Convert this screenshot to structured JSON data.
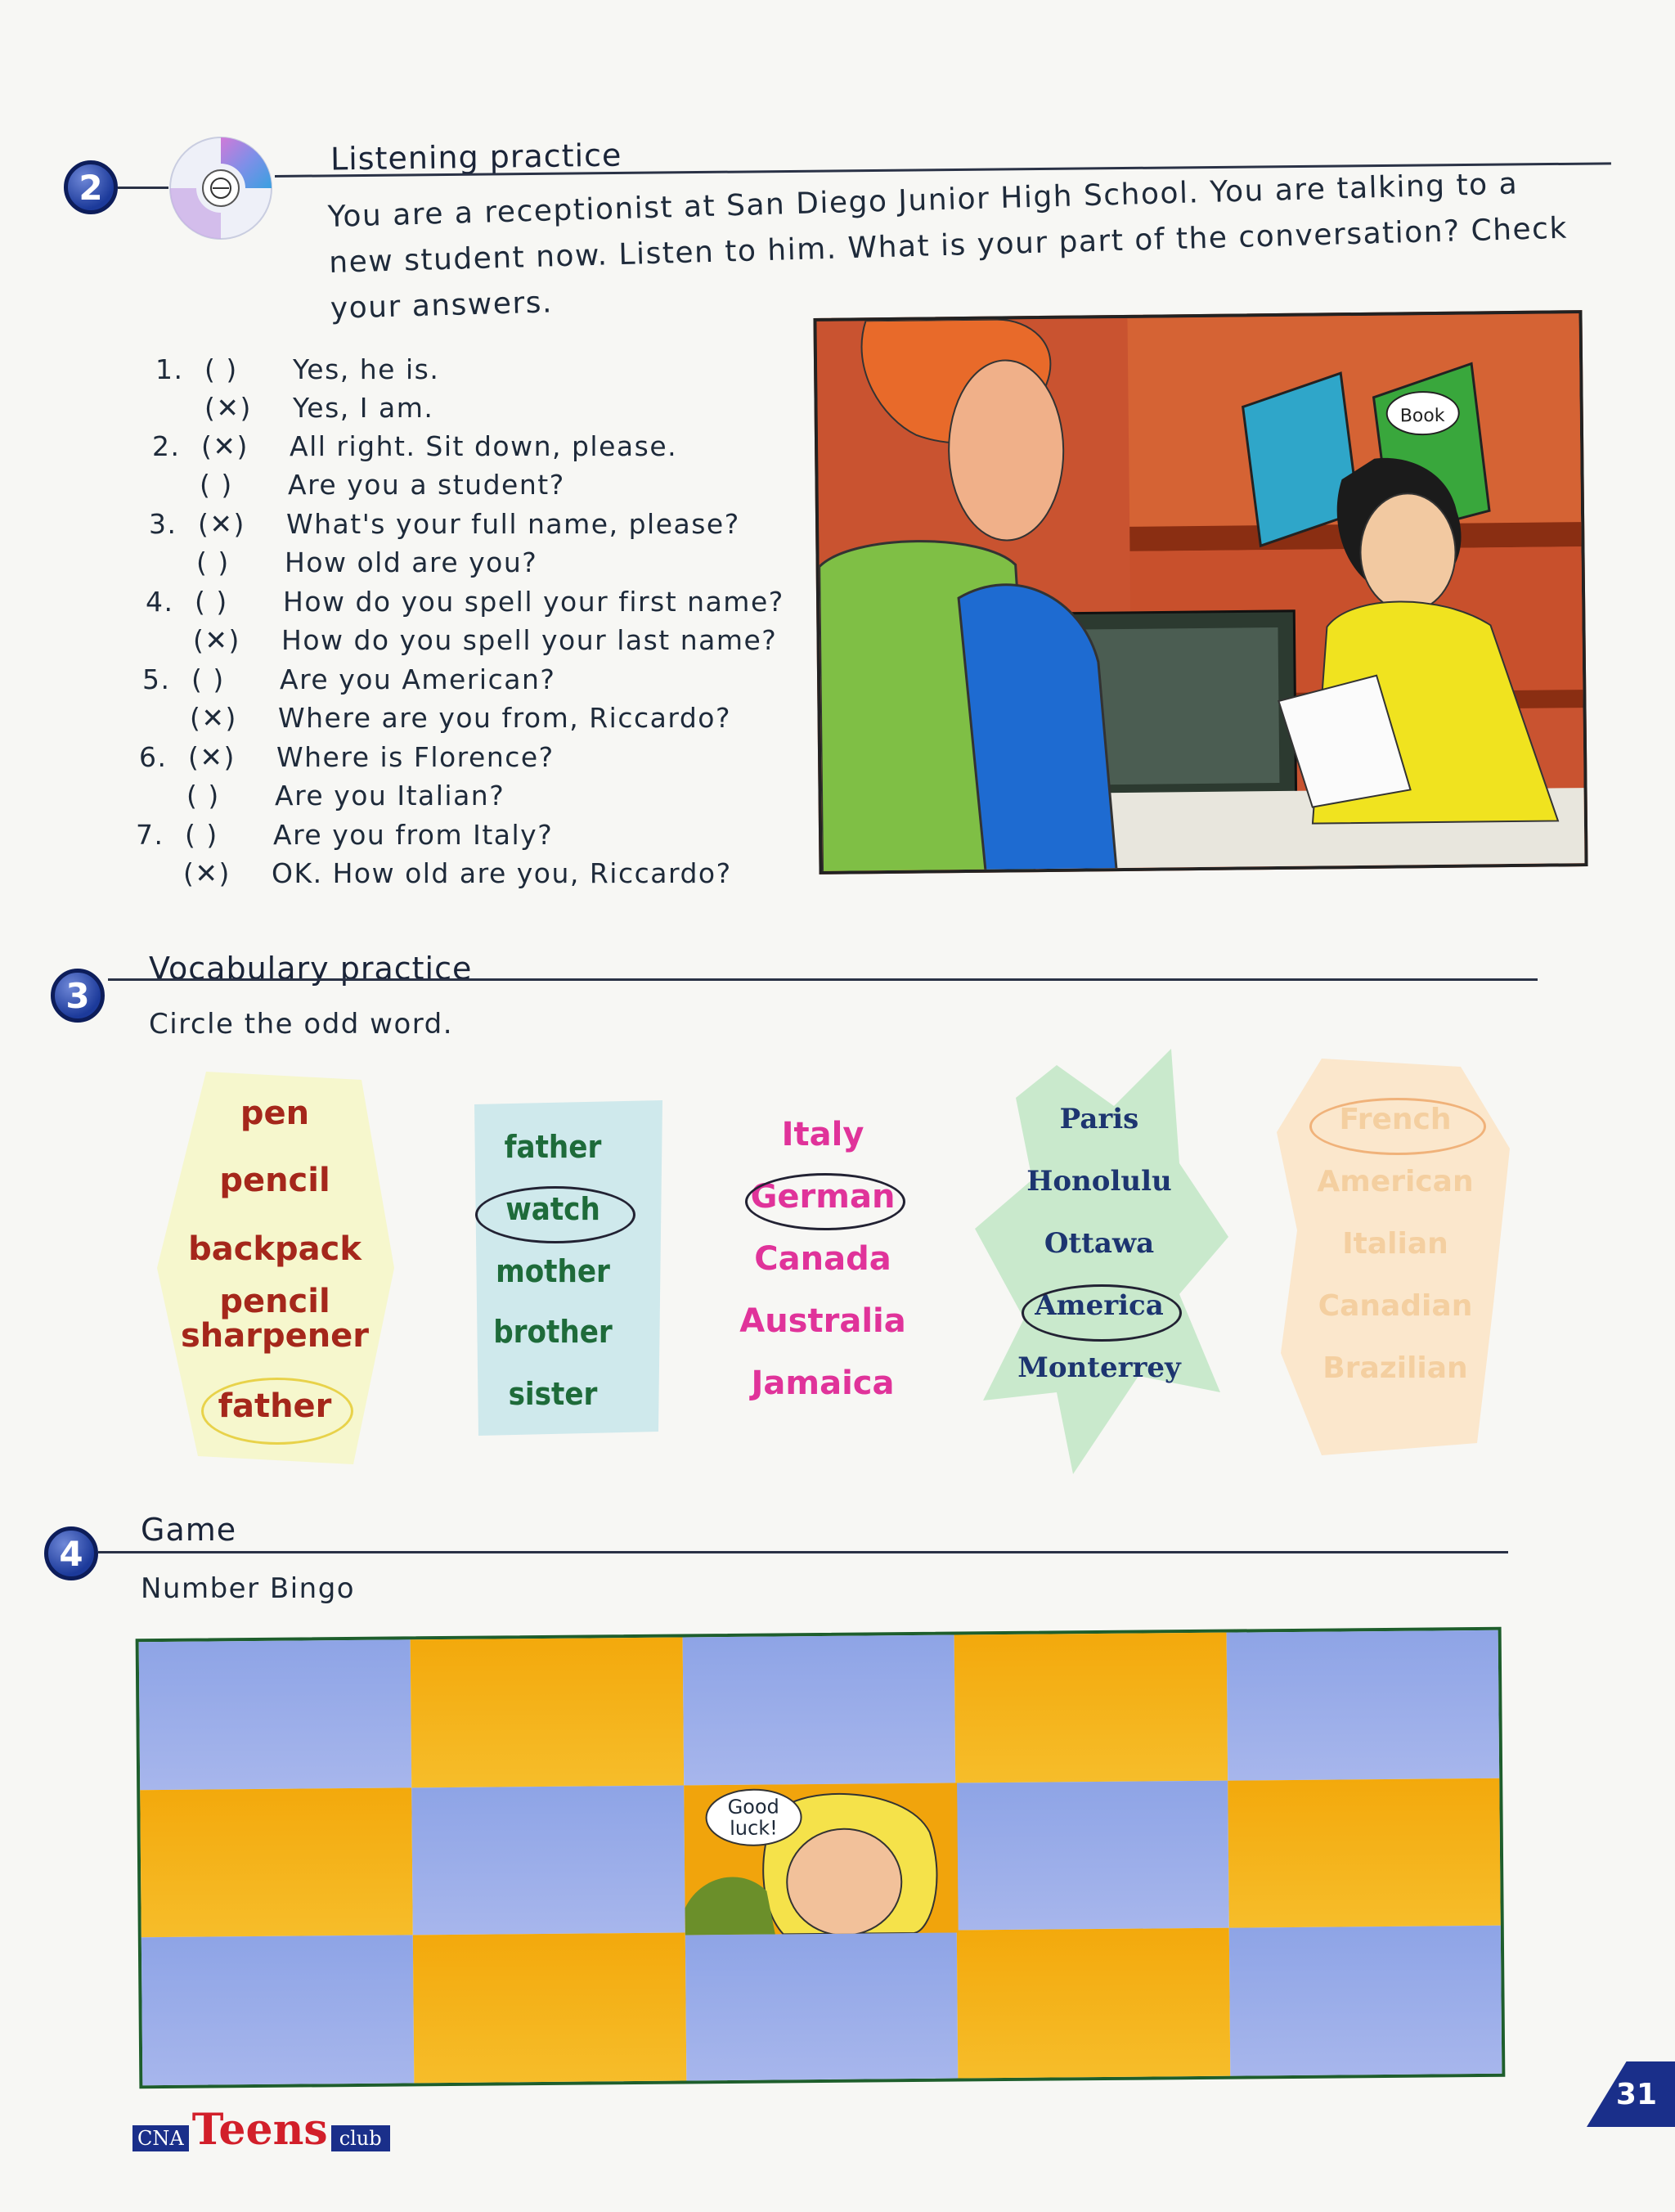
{
  "listening": {
    "number": "2",
    "title": "Listening practice",
    "instruction": "You are a receptionist at San Diego Junior High School. You are talking to a new student now. Listen to him. What is your part of the conversation? Check your answers.",
    "items": [
      {
        "num": "1.",
        "check": "(     )",
        "text": "Yes, he is."
      },
      {
        "num": "",
        "check": "(✕)",
        "text": "Yes, I am."
      },
      {
        "num": "2.",
        "check": "(✕)",
        "text": "All right. Sit down, please."
      },
      {
        "num": "",
        "check": "(     )",
        "text": "Are you a student?"
      },
      {
        "num": "3.",
        "check": "(✕)",
        "text": "What's your full name, please?"
      },
      {
        "num": "",
        "check": "(     )",
        "text": "How old are you?"
      },
      {
        "num": "4.",
        "check": "(     )",
        "text": "How do you spell your first name?"
      },
      {
        "num": "",
        "check": "(✕)",
        "text": "How do you spell your last name?"
      },
      {
        "num": "5.",
        "check": "(     )",
        "text": "Are you American?"
      },
      {
        "num": "",
        "check": "(✕)",
        "text": "Where are you from, Riccardo?"
      },
      {
        "num": "6.",
        "check": "(✕)",
        "text": "Where is Florence?"
      },
      {
        "num": "",
        "check": "(     )",
        "text": "Are you Italian?"
      },
      {
        "num": "7.",
        "check": "(     )",
        "text": "Are you from Italy?"
      },
      {
        "num": "",
        "check": "(✕)",
        "text": "OK. How old are you, Riccardo?"
      }
    ],
    "illustration": {
      "book_label": "Book"
    }
  },
  "vocabulary": {
    "number": "3",
    "title": "Vocabulary practice",
    "instruction": "Circle the odd word.",
    "groups": [
      {
        "words": [
          "pen",
          "pencil",
          "backpack",
          "pencil sharpener",
          "father"
        ],
        "circled": "father",
        "color": "#a5271b"
      },
      {
        "words": [
          "father",
          "watch",
          "mother",
          "brother",
          "sister"
        ],
        "circled": "watch",
        "color": "#1e6b3a"
      },
      {
        "words": [
          "Italy",
          "German",
          "Canada",
          "Australia",
          "Jamaica"
        ],
        "circled": "German",
        "color": "#e0339a"
      },
      {
        "words": [
          "Paris",
          "Honolulu",
          "Ottawa",
          "America",
          "Monterrey"
        ],
        "circled": "America",
        "color": "#1d3570"
      },
      {
        "words": [
          "French",
          "American",
          "Italian",
          "Canadian",
          "Brazilian"
        ],
        "circled": "French",
        "color": "#f4cfa0"
      }
    ]
  },
  "game": {
    "number": "4",
    "title": "Game",
    "subtitle": "Number Bingo",
    "speech": "Good luck!"
  },
  "footer": {
    "logo_prefix": "CNA",
    "logo_main": "Teens",
    "logo_suffix": "club",
    "page_number": "31"
  }
}
